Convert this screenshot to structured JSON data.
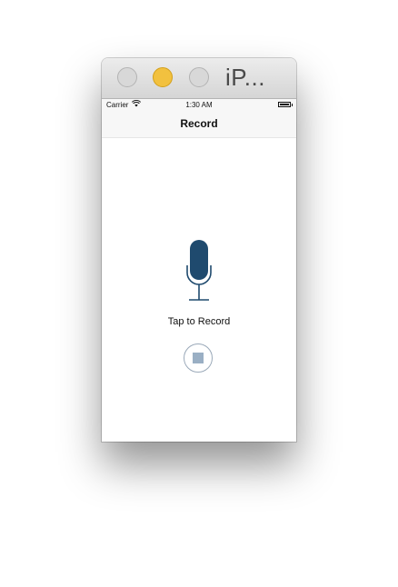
{
  "window": {
    "title": "iP...",
    "accent_color": "#f2c13f"
  },
  "status_bar": {
    "carrier": "Carrier",
    "time": "1:30 AM"
  },
  "nav": {
    "title": "Record"
  },
  "recorder": {
    "prompt": "Tap to Record",
    "mic_color": "#1f4a6e",
    "stop_color": "#9aafc4"
  },
  "icons": [
    "wifi-icon",
    "battery-icon",
    "microphone-icon",
    "stop-icon"
  ]
}
